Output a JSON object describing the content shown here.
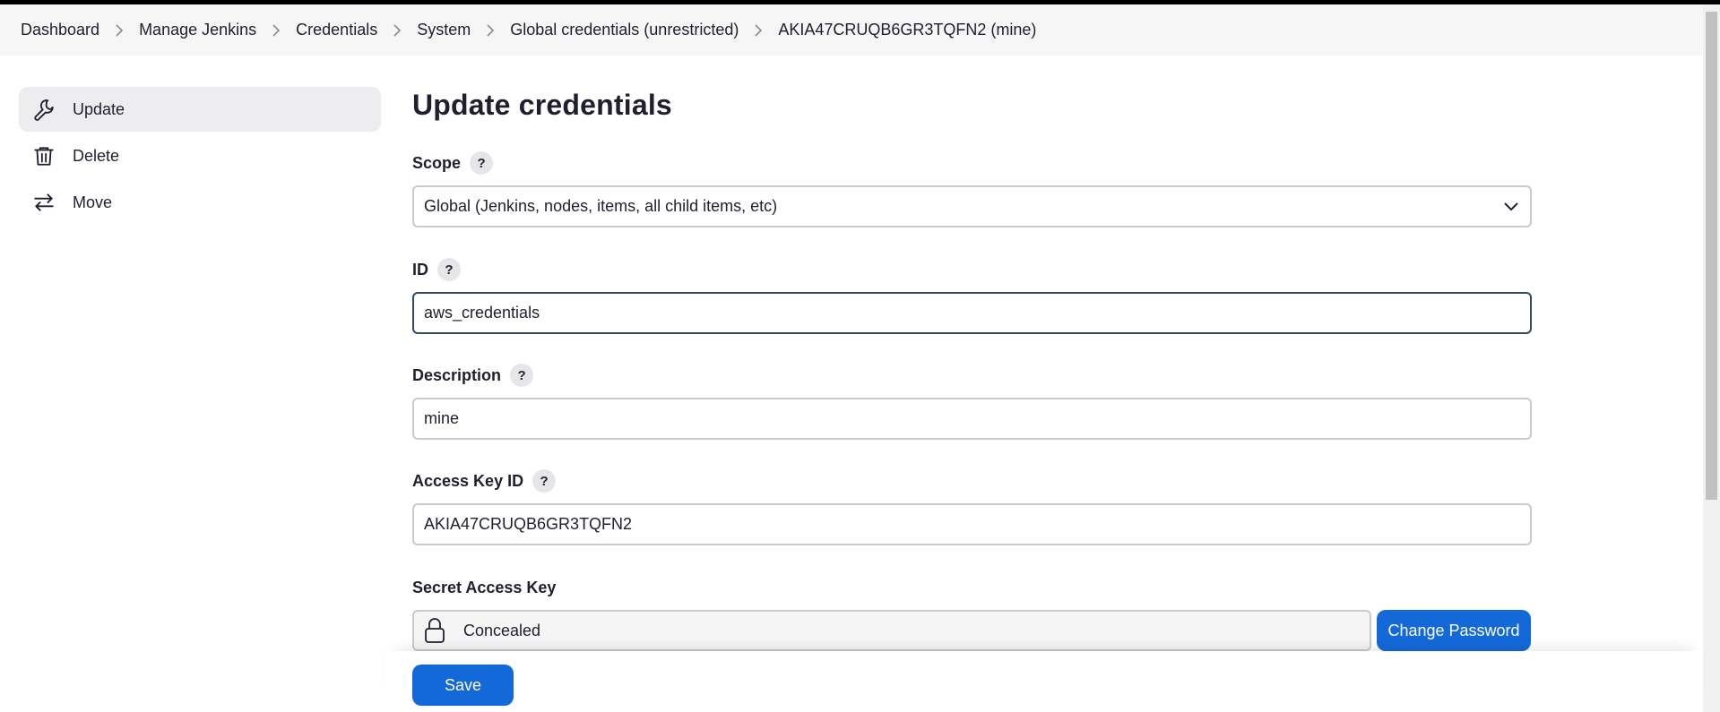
{
  "breadcrumb": [
    {
      "label": "Dashboard"
    },
    {
      "label": "Manage Jenkins"
    },
    {
      "label": "Credentials"
    },
    {
      "label": "System"
    },
    {
      "label": "Global credentials (unrestricted)"
    },
    {
      "label": "AKIA47CRUQB6GR3TQFN2 (mine)"
    }
  ],
  "sidebar": {
    "items": [
      {
        "label": "Update",
        "icon": "wrench-icon",
        "active": true
      },
      {
        "label": "Delete",
        "icon": "trash-icon",
        "active": false
      },
      {
        "label": "Move",
        "icon": "arrows-swap-icon",
        "active": false
      }
    ]
  },
  "main": {
    "title": "Update credentials",
    "scope": {
      "label": "Scope",
      "help": "?",
      "value": "Global (Jenkins, nodes, items, all child items, etc)"
    },
    "id": {
      "label": "ID",
      "help": "?",
      "value": "aws_credentials"
    },
    "description": {
      "label": "Description",
      "help": "?",
      "value": "mine"
    },
    "access_key": {
      "label": "Access Key ID",
      "help": "?",
      "value": "AKIA47CRUQB6GR3TQFN2"
    },
    "secret": {
      "label": "Secret Access Key",
      "value": "Concealed",
      "button": "Change Password"
    },
    "save": "Save"
  },
  "colors": {
    "accent": "#1469d9",
    "focus_border": "#2f4a62",
    "breadcrumb_bg": "#f6f6f7"
  }
}
